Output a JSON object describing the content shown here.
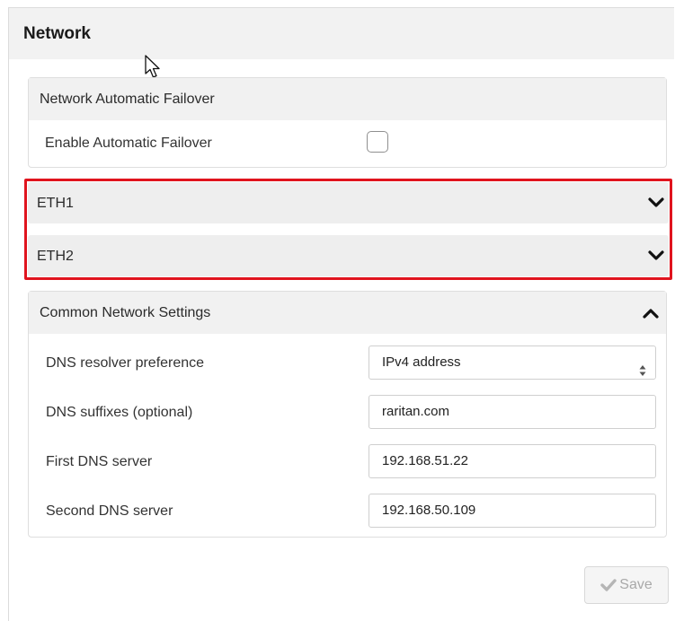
{
  "page": {
    "title": "Network"
  },
  "failover": {
    "title": "Network Automatic Failover",
    "enable_label": "Enable Automatic Failover",
    "enabled": false
  },
  "interfaces": [
    {
      "label": "ETH1",
      "expanded": false
    },
    {
      "label": "ETH2",
      "expanded": false
    }
  ],
  "common": {
    "title": "Common Network Settings",
    "expanded": true,
    "dns_pref_label": "DNS resolver preference",
    "dns_pref_value": "IPv4 address",
    "dns_suffix_label": "DNS suffixes (optional)",
    "dns_suffix_value": "raritan.com",
    "dns1_label": "First DNS server",
    "dns1_value": "192.168.51.22",
    "dns2_label": "Second DNS server",
    "dns2_value": "192.168.50.109"
  },
  "actions": {
    "save_label": "Save",
    "save_enabled": false
  },
  "colors": {
    "highlight": "#e0141e",
    "header_bg": "#f2f2f2",
    "disabled_text": "#a9a9a9"
  },
  "icons": {
    "expand": "chevron-down-icon",
    "collapse": "chevron-up-icon",
    "save": "check-icon",
    "select": "select-arrows-icon",
    "cursor": "mouse-pointer-icon"
  }
}
